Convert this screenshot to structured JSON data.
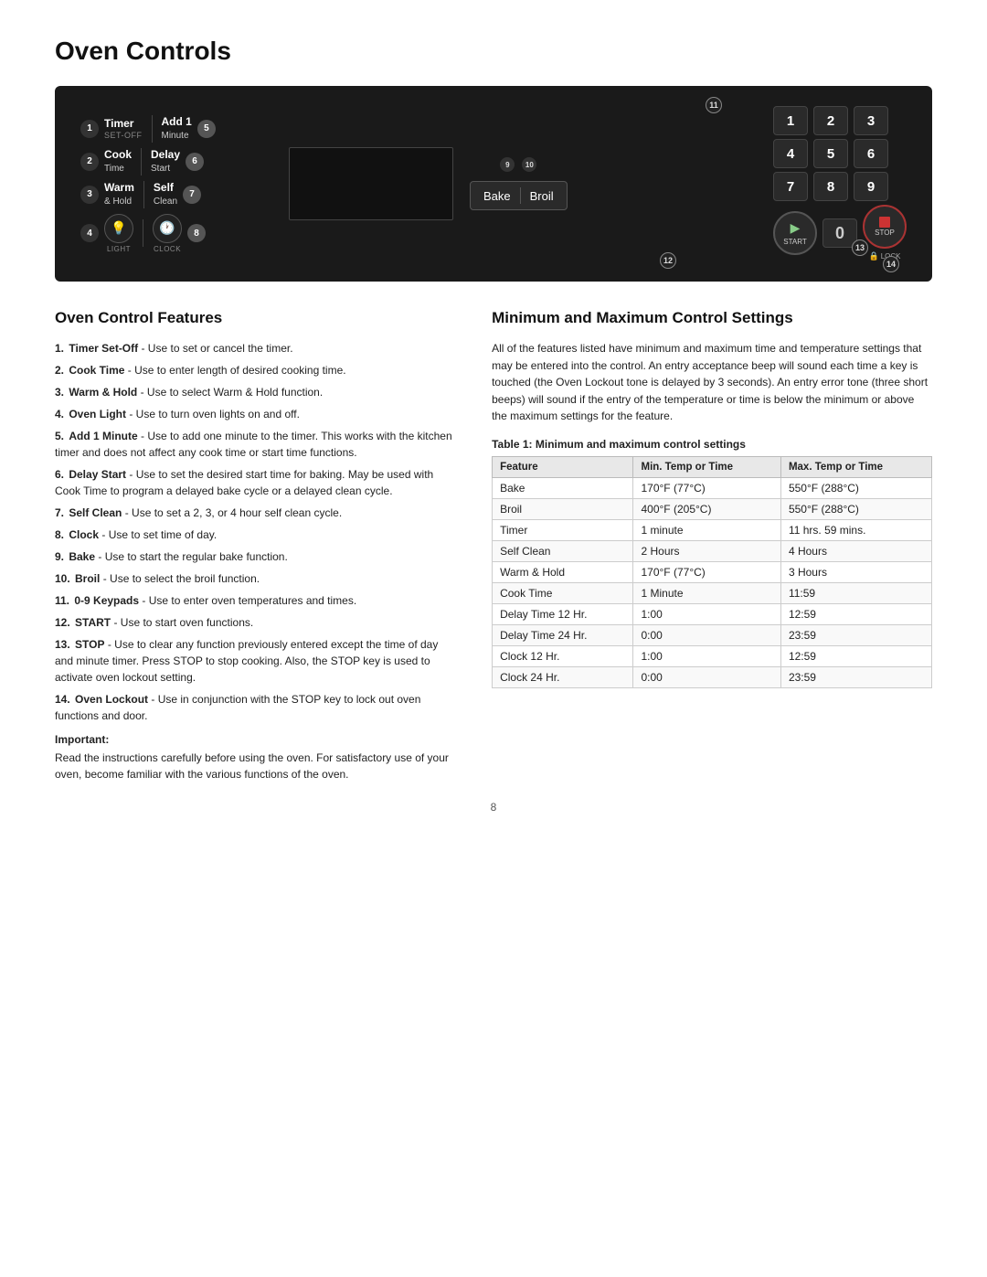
{
  "page": {
    "title": "Oven Controls",
    "page_number": "8"
  },
  "panel": {
    "buttons": [
      {
        "num": "1",
        "label": "Timer",
        "sub": "SET-OFF"
      },
      {
        "num": "2",
        "label": "Cook Time",
        "sub": ""
      },
      {
        "num": "3",
        "label": "Warm & Hold",
        "sub": ""
      },
      {
        "num": "4",
        "label": "LIGHT",
        "sub": ""
      },
      {
        "num": "5",
        "label": "Add 1 Minute",
        "sub": ""
      },
      {
        "num": "6",
        "label": "Delay Start",
        "sub": ""
      },
      {
        "num": "7",
        "label": "Self Clean",
        "sub": ""
      },
      {
        "num": "8",
        "label": "CLOCK",
        "sub": ""
      }
    ],
    "keypad": [
      "1",
      "2",
      "3",
      "4",
      "5",
      "6",
      "7",
      "8",
      "9",
      "0"
    ],
    "bake_label": "Bake",
    "broil_label": "Broil",
    "start_label": "START",
    "stop_label": "STOP",
    "lock_label": "LOCK",
    "circle_9": "9",
    "circle_10": "10",
    "circle_11": "11",
    "circle_12": "12",
    "circle_13": "13",
    "circle_14": "14"
  },
  "features": {
    "title": "Oven Control Features",
    "items": [
      {
        "num": "1.",
        "bold": "Timer Set-Off",
        "text": " - Use to set or cancel the timer."
      },
      {
        "num": "2.",
        "bold": "Cook Time",
        "text": " - Use to enter length of desired cooking time."
      },
      {
        "num": "3.",
        "bold": "Warm & Hold",
        "text": " - Use to select Warm & Hold function."
      },
      {
        "num": "4.",
        "bold": "Oven Light",
        "text": " - Use to turn oven lights on and off."
      },
      {
        "num": "5.",
        "bold": "Add 1 Minute",
        "text": " - Use to add one minute to the timer. This works with the kitchen timer and does not affect any cook time or start time functions."
      },
      {
        "num": "6.",
        "bold": "Delay Start",
        "text": " - Use to set the desired start time for baking. May be used with Cook Time to program a delayed bake cycle or a delayed clean cycle."
      },
      {
        "num": "7.",
        "bold": "Self Clean",
        "text": " - Use to set a 2, 3, or 4 hour self clean cycle."
      },
      {
        "num": "8.",
        "bold": "Clock",
        "text": " - Use to set time of day."
      },
      {
        "num": "9.",
        "bold": "Bake",
        "text": " - Use to start the regular bake function."
      },
      {
        "num": "10.",
        "bold": "Broil",
        "text": " - Use to select the broil function."
      },
      {
        "num": "11.",
        "bold": "0-9 Keypads",
        "text": " - Use to enter oven temperatures and times."
      },
      {
        "num": "12.",
        "bold": "START",
        "text": " - Use to start oven functions."
      },
      {
        "num": "13.",
        "bold": "STOP",
        "text": " - Use to clear any function previously entered except the time of day and minute timer. Press STOP to stop cooking. Also, the STOP key is used to activate oven lockout setting."
      },
      {
        "num": "14.",
        "bold": "Oven Lockout",
        "text": " - Use in conjunction with the STOP key to lock out oven functions and door."
      }
    ],
    "important_label": "Important:",
    "important_text": "Read the instructions carefully before using the oven. For satisfactory use of your oven, become familiar with the various functions of the oven."
  },
  "settings": {
    "title": "Minimum and Maximum Control Settings",
    "description": "All of the features listed have minimum and maximum time and temperature settings that may be entered into the control. An entry acceptance beep will sound each time a key is touched (the Oven Lockout tone is delayed by 3 seconds). An entry error tone (three short beeps) will sound if the entry of the temperature or time is below the minimum or above the maximum settings for the feature.",
    "table_caption": "Table 1:  Minimum and maximum control settings",
    "columns": [
      "Feature",
      "Min. Temp or Time",
      "Max. Temp or Time"
    ],
    "rows": [
      [
        "Bake",
        "170°F (77°C)",
        "550°F (288°C)"
      ],
      [
        "Broil",
        "400°F (205°C)",
        "550°F (288°C)"
      ],
      [
        "Timer",
        "1 minute",
        "11 hrs. 59 mins."
      ],
      [
        "Self Clean",
        "2 Hours",
        "4 Hours"
      ],
      [
        "Warm & Hold",
        "170°F (77°C)",
        "3 Hours"
      ],
      [
        "Cook Time",
        "1 Minute",
        "11:59"
      ],
      [
        "Delay Time 12 Hr.",
        "1:00",
        "12:59"
      ],
      [
        "Delay Time 24 Hr.",
        "0:00",
        "23:59"
      ],
      [
        "Clock 12 Hr.",
        "1:00",
        "12:59"
      ],
      [
        "Clock 24 Hr.",
        "0:00",
        "23:59"
      ]
    ]
  }
}
